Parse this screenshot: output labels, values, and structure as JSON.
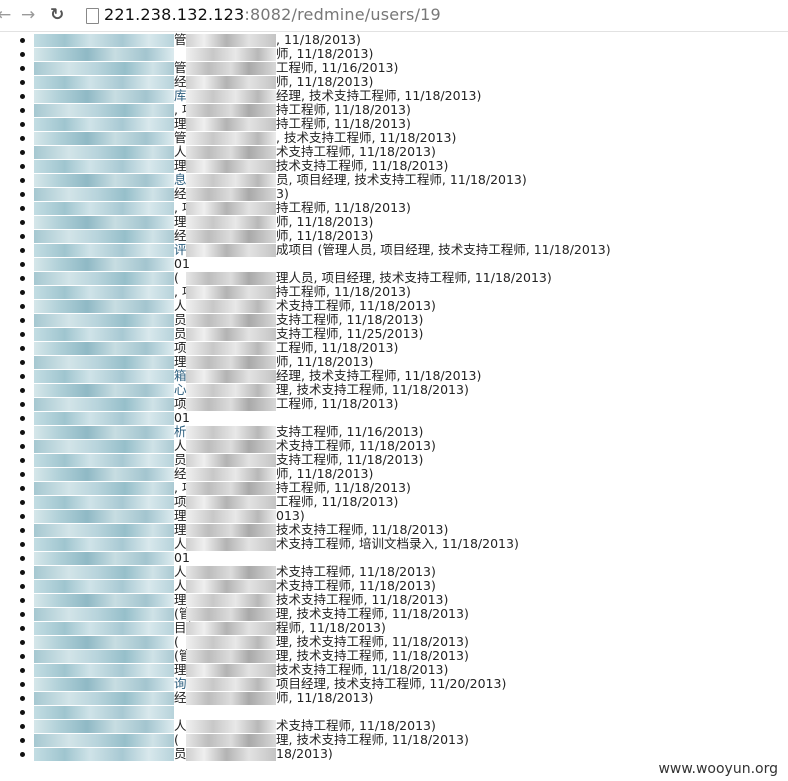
{
  "browser": {
    "back_icon": "←",
    "forward_icon": "→",
    "reload_icon": "↻",
    "url_host": "221.238.132.123",
    "url_rest": ":8082/redmine/users/19"
  },
  "rows": [
    {
      "t": "管",
      "s": ", 11/18/2013)"
    },
    {
      "t": "",
      "s": "师, 11/18/2013)"
    },
    {
      "t": "管",
      "s": "工程师, 11/16/2013)"
    },
    {
      "t": "经",
      "s": "师, 11/18/2013)"
    },
    {
      "t": "库",
      "s": "经理, 技术支持工程师, 11/18/2013)",
      "link": true
    },
    {
      "t": ", 项",
      "s": "持工程师, 11/18/2013)"
    },
    {
      "t": "理, L",
      "s": "持工程师, 11/18/2013)"
    },
    {
      "t": "管",
      "s": ", 技术支持工程师, 11/18/2013)"
    },
    {
      "t": "人",
      "s": "术支持工程师, 11/18/2013)"
    },
    {
      "t": "理",
      "s": "技术支持工程师, 11/18/2013)"
    },
    {
      "t": "息",
      "s": "员, 项目经理, 技术支持工程师, 11/18/2013)",
      "link": true
    },
    {
      "t": "经",
      "s": "3)"
    },
    {
      "t": ", 项",
      "s": "持工程师, 11/18/2013)"
    },
    {
      "t": "理",
      "s": "师, 11/18/2013)"
    },
    {
      "t": "经",
      "s": "师, 11/18/2013)"
    },
    {
      "t": "评",
      "s": "成项目 (管理人员, 项目经理, 技术支持工程师, 11/18/2013)",
      "link": true
    },
    {
      "t": "01",
      "s": ""
    },
    {
      "t": "(",
      "s": "理人员, 项目经理, 技术支持工程师, 11/18/2013)"
    },
    {
      "t": ", 项",
      "s": "持工程师, 11/18/2013)"
    },
    {
      "t": "人",
      "s": "术支持工程师, 11/18/2013)"
    },
    {
      "t": "员",
      "s": "支持工程师, 11/18/2013)"
    },
    {
      "t": "员",
      "s": "支持工程师, 11/25/2013)"
    },
    {
      "t": "项",
      "s": "工程师, 11/18/2013)"
    },
    {
      "t": "理",
      "s": "师, 11/18/2013)"
    },
    {
      "t": "箱",
      "s": "经理, 技术支持工程师, 11/18/2013)",
      "link": true
    },
    {
      "t": "心",
      "s": "理, 技术支持工程师, 11/18/2013)",
      "link": true
    },
    {
      "t": "项目",
      "s": "工程师, 11/18/2013)"
    },
    {
      "t": "01",
      "s": ""
    },
    {
      "t": "析",
      "s": "支持工程师, 11/16/2013)",
      "link": true
    },
    {
      "t": "人",
      "s": "术支持工程师, 11/18/2013)"
    },
    {
      "t": "员",
      "s": "支持工程师, 11/18/2013)"
    },
    {
      "t": "经",
      "s": "师, 11/18/2013)"
    },
    {
      "t": ", 项",
      "s": "持工程师, 11/18/2013)"
    },
    {
      "t": "项",
      "s": "工程师, 11/18/2013)"
    },
    {
      "t": "理",
      "s": "013)"
    },
    {
      "t": "理",
      "s": "技术支持工程师, 11/18/2013)"
    },
    {
      "t": "人",
      "s": "术支持工程师, 培训文档录入, 11/18/2013)"
    },
    {
      "t": "01",
      "s": ""
    },
    {
      "t": "人",
      "s": "术支持工程师, 11/18/2013)"
    },
    {
      "t": "人",
      "s": "术支持工程师, 11/18/2013)"
    },
    {
      "t": "理",
      "s": "技术支持工程师, 11/18/2013)"
    },
    {
      "t": "(管",
      "s": "理, 技术支持工程师, 11/18/2013)"
    },
    {
      "t": "目经",
      "s": "程师, 11/18/2013)"
    },
    {
      "t": "(",
      "s": "理, 技术支持工程师, 11/18/2013)"
    },
    {
      "t": "(管",
      "s": "理, 技术支持工程师, 11/18/2013)"
    },
    {
      "t": "理",
      "s": "技术支持工程师, 11/18/2013)"
    },
    {
      "t": "询",
      "s": "项目经理, 技术支持工程师, 11/20/2013)",
      "link": true
    },
    {
      "t": "经",
      "s": "师, 11/18/2013)"
    },
    {
      "t": "",
      "s": ""
    },
    {
      "t": "人",
      "s": "术支持工程师, 11/18/2013)"
    },
    {
      "t": "(",
      "s": "理, 技术支持工程师, 11/18/2013)"
    },
    {
      "t": "员",
      "s": "18/2013)"
    }
  ],
  "watermark": "www.wooyun.org"
}
